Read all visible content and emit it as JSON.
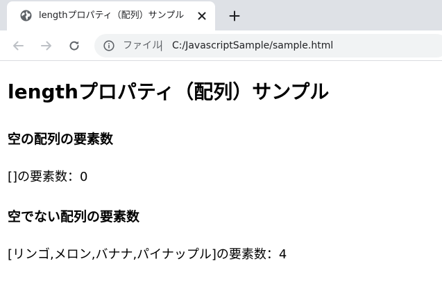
{
  "browser": {
    "tab": {
      "title": "lengthプロパティ（配列）サンプル",
      "favicon": "globe-icon",
      "close": "close-icon"
    },
    "new_tab": "plus-icon",
    "nav": {
      "back": "arrow-left-icon",
      "forward": "arrow-right-icon",
      "reload": "reload-icon"
    },
    "address": {
      "security_icon": "info-icon",
      "scheme_label": "ファイル",
      "separator": "|",
      "url": "C:/JavascriptSample/sample.html"
    }
  },
  "page": {
    "title": "lengthプロパティ（配列）サンプル",
    "sections": [
      {
        "heading": "空の配列の要素数",
        "result": "[]の要素数：0"
      },
      {
        "heading": "空でない配列の要素数",
        "result": "[リンゴ,メロン,バナナ,パイナップル]の要素数：4"
      }
    ]
  },
  "colors": {
    "tabstrip": "#dee1e6",
    "omnibox": "#f1f3f4",
    "icon": "#5f6368",
    "icon_disabled": "#bdc1c6"
  }
}
